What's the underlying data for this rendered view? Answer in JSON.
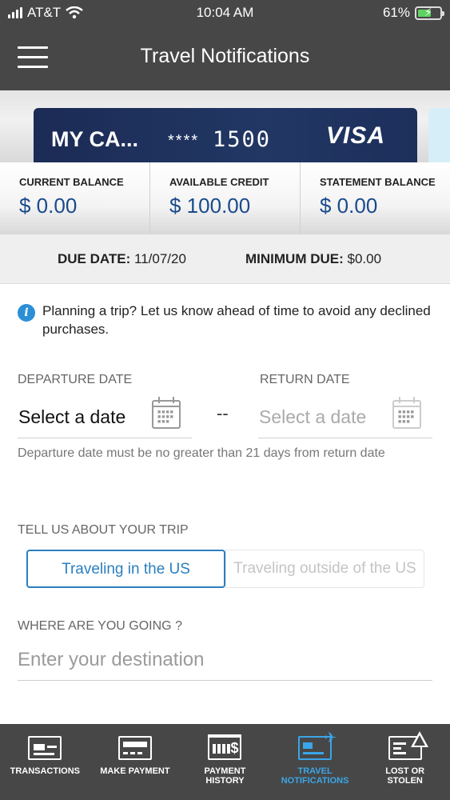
{
  "status_bar": {
    "carrier": "AT&T",
    "time": "10:04 AM",
    "battery_percent": "61%",
    "battery_level": 0.61,
    "icons": [
      "signal-icon",
      "wifi-icon",
      "battery-charging-icon"
    ]
  },
  "header": {
    "title": "Travel Notifications",
    "menu_icon": "hamburger-menu-icon"
  },
  "card": {
    "name": "MY CA...",
    "masked": "****",
    "last4": "1500",
    "network": "VISA",
    "colors": {
      "card_bg": "#1d2f5c",
      "next_card_bg": "#d6eef7"
    }
  },
  "balances": [
    {
      "label": "CURRENT BALANCE",
      "value": "$ 0.00"
    },
    {
      "label": "AVAILABLE CREDIT",
      "value": "$ 100.00"
    },
    {
      "label": "STATEMENT BALANCE",
      "value": "$ 0.00"
    }
  ],
  "due": {
    "due_date_label": "DUE DATE:",
    "due_date_value": "11/07/20",
    "min_due_label": "MINIMUM DUE:",
    "min_due_value": "$0.00"
  },
  "info": {
    "icon": "info-icon",
    "text": "Planning a trip? Let us know ahead of time to avoid any declined purchases."
  },
  "dates": {
    "departure_label": "DEPARTURE DATE",
    "departure_value": "Select a date",
    "return_label": "RETURN DATE",
    "return_value": "Select a date",
    "separator": "--",
    "calendar_icon": "calendar-icon",
    "hint": "Departure date must be no greater than 21 days from return date"
  },
  "trip": {
    "label": "TELL US ABOUT YOUR TRIP",
    "options": [
      "Traveling in the US",
      "Traveling outside of the US"
    ],
    "selected": "Traveling in the US"
  },
  "destination": {
    "label": "WHERE ARE YOU GOING ?",
    "placeholder": "Enter your destination",
    "value": ""
  },
  "bottom_nav": {
    "items": [
      {
        "label": "TRANSACTIONS",
        "icon": "transactions-icon"
      },
      {
        "label": "MAKE PAYMENT",
        "icon": "make-payment-icon"
      },
      {
        "label_line1": "PAYMENT",
        "label_line2": "HISTORY",
        "icon": "payment-history-icon"
      },
      {
        "label_line1": "TRAVEL",
        "label_line2": "NOTIFICATIONS",
        "icon": "travel-notifications-icon",
        "active": true
      },
      {
        "label_line1": "LOST OR",
        "label_line2": "STOLEN",
        "icon": "lost-stolen-icon"
      }
    ],
    "active_color": "#3aa6e8"
  },
  "colors": {
    "header_bg": "#474747",
    "accent": "#2b7fc1",
    "balance_value": "#1a4a8c"
  }
}
